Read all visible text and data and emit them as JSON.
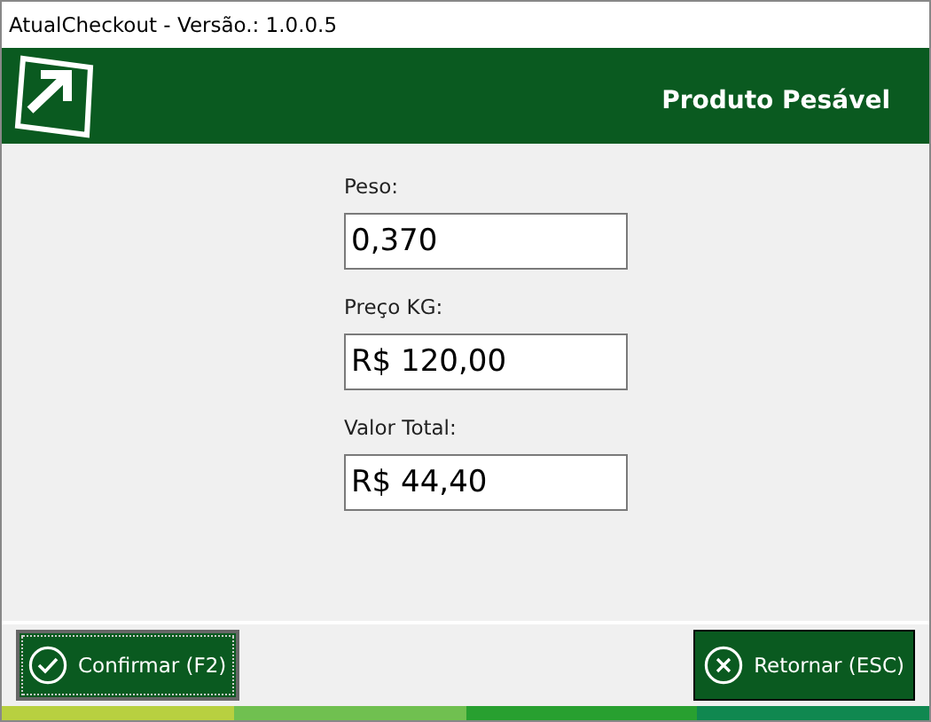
{
  "window": {
    "title": "AtualCheckout - Versão.: 1.0.0.5"
  },
  "header": {
    "title": "Produto Pesável"
  },
  "fields": [
    {
      "label": "Peso:",
      "value": "0,370"
    },
    {
      "label": "Preço KG:",
      "value": "R$ 120,00"
    },
    {
      "label": "Valor Total:",
      "value": "R$ 44,40"
    }
  ],
  "buttons": [
    {
      "kind": "confirm",
      "label": "Confirmar (F2)",
      "focused": true
    },
    {
      "kind": "cancel",
      "label": "Retornar (ESC)",
      "focused": false
    }
  ]
}
